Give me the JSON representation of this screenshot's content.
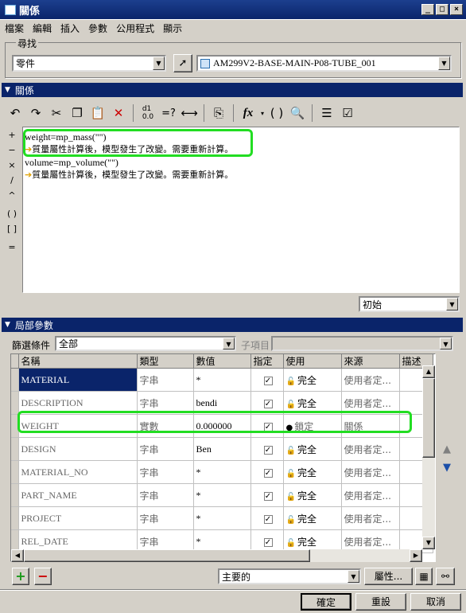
{
  "window": {
    "title": "關係"
  },
  "menu": {
    "items": [
      "檔案",
      "編輯",
      "插入",
      "參數",
      "公用程式",
      "顯示"
    ]
  },
  "find": {
    "label": "尋找",
    "type_value": "零件",
    "model_value": "AM299V2-BASE-MAIN-P08-TUBE_001"
  },
  "relations": {
    "section_title": "關係",
    "lines": [
      "weight=mp_mass(\"\")",
      "質量屬性計算後，模型發生了改變。需要重新計算。",
      "volume=mp_volume(\"\")",
      "質量屬性計算後，模型發生了改變。需要重新計算。"
    ],
    "side_ops": [
      "+",
      "−",
      "×",
      "/",
      "^",
      "( )",
      "[ ]",
      "="
    ],
    "view_value": "初始"
  },
  "local_params": {
    "section_title": "局部參數",
    "filter_label": "篩選條件",
    "filter_value": "全部",
    "subitem_label": "子項目",
    "columns": [
      "名稱",
      "類型",
      "數值",
      "指定",
      "使用",
      "來源",
      "描述"
    ],
    "rows": [
      {
        "name": "MATERIAL",
        "type": "字串",
        "value": "*",
        "designated": true,
        "access": "完全",
        "source": "使用者定..."
      },
      {
        "name": "DESCRIPTION",
        "type": "字串",
        "value": "bendi",
        "designated": true,
        "access": "完全",
        "source": "使用者定..."
      },
      {
        "name": "WEIGHT",
        "type": "實數",
        "value": "0.000000",
        "designated": true,
        "access": "鎖定",
        "source": "關係"
      },
      {
        "name": "DESIGN",
        "type": "字串",
        "value": "Ben",
        "designated": true,
        "access": "完全",
        "source": "使用者定..."
      },
      {
        "name": "MATERIAL_NO",
        "type": "字串",
        "value": "*",
        "designated": true,
        "access": "完全",
        "source": "使用者定..."
      },
      {
        "name": "PART_NAME",
        "type": "字串",
        "value": "*",
        "designated": true,
        "access": "完全",
        "source": "使用者定..."
      },
      {
        "name": "PROJECT",
        "type": "字串",
        "value": "*",
        "designated": true,
        "access": "完全",
        "source": "使用者定..."
      },
      {
        "name": "REL_DATE",
        "type": "字串",
        "value": "*",
        "designated": true,
        "access": "完全",
        "source": "使用者定..."
      }
    ],
    "main_value": "主要的",
    "properties_label": "屬性..."
  },
  "buttons": {
    "ok": "確定",
    "reset": "重設",
    "cancel": "取消"
  }
}
